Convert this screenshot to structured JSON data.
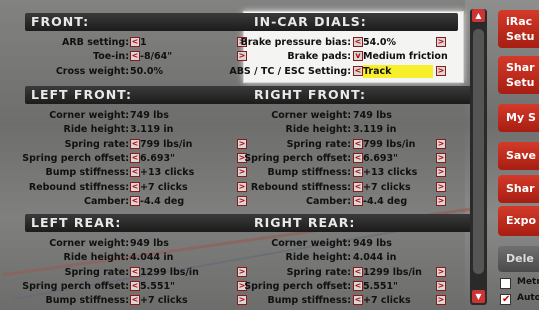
{
  "front": {
    "title": "FRONT:",
    "rows": [
      {
        "label": "ARB setting:",
        "value": "1",
        "adjustable": true
      },
      {
        "label": "Toe-in:",
        "value": "-8/64\"",
        "adjustable": true
      },
      {
        "label": "Cross weight:",
        "value": "50.0%",
        "adjustable": false
      }
    ]
  },
  "dials": {
    "title": "IN-CAR DIALS:",
    "rows": [
      {
        "label": "Brake pressure bias:",
        "value": "54.0%",
        "adjustable": true
      },
      {
        "label": "Brake pads:",
        "value": "Medium friction",
        "adjustable": "dropdown"
      },
      {
        "label": "ABS / TC / ESC Setting:",
        "value": "Track",
        "adjustable": true,
        "highlight": true
      }
    ]
  },
  "left_front": {
    "title": "LEFT FRONT:",
    "rows": [
      {
        "label": "Corner weight:",
        "value": "749 lbs",
        "adjustable": false
      },
      {
        "label": "Ride height:",
        "value": "3.119 in",
        "adjustable": false
      },
      {
        "label": "Spring rate:",
        "value": "799 lbs/in",
        "adjustable": true
      },
      {
        "label": "Spring perch offset:",
        "value": "6.693\"",
        "adjustable": true
      },
      {
        "label": "Bump stiffness:",
        "value": "+13 clicks",
        "adjustable": true
      },
      {
        "label": "Rebound stiffness:",
        "value": "+7 clicks",
        "adjustable": true
      },
      {
        "label": "Camber:",
        "value": "-4.4 deg",
        "adjustable": true
      }
    ]
  },
  "right_front": {
    "title": "RIGHT FRONT:",
    "rows": [
      {
        "label": "Corner weight:",
        "value": "749 lbs",
        "adjustable": false
      },
      {
        "label": "Ride height:",
        "value": "3.119 in",
        "adjustable": false
      },
      {
        "label": "Spring rate:",
        "value": "799 lbs/in",
        "adjustable": true
      },
      {
        "label": "Spring perch offset:",
        "value": "6.693\"",
        "adjustable": true
      },
      {
        "label": "Bump stiffness:",
        "value": "+13 clicks",
        "adjustable": true
      },
      {
        "label": "Rebound stiffness:",
        "value": "+7 clicks",
        "adjustable": true
      },
      {
        "label": "Camber:",
        "value": "-4.4 deg",
        "adjustable": true
      }
    ]
  },
  "left_rear": {
    "title": "LEFT REAR:",
    "rows": [
      {
        "label": "Corner weight:",
        "value": "949 lbs",
        "adjustable": false
      },
      {
        "label": "Ride height:",
        "value": "4.044 in",
        "adjustable": false
      },
      {
        "label": "Spring rate:",
        "value": "1299 lbs/in",
        "adjustable": true
      },
      {
        "label": "Spring perch offset:",
        "value": "5.551\"",
        "adjustable": true
      },
      {
        "label": "Bump stiffness:",
        "value": "+7 clicks",
        "adjustable": true
      }
    ]
  },
  "right_rear": {
    "title": "RIGHT REAR:",
    "rows": [
      {
        "label": "Corner weight:",
        "value": "949 lbs",
        "adjustable": false
      },
      {
        "label": "Ride height:",
        "value": "4.044 in",
        "adjustable": false
      },
      {
        "label": "Spring rate:",
        "value": "1299 lbs/in",
        "adjustable": true
      },
      {
        "label": "Spring perch offset:",
        "value": "5.551\"",
        "adjustable": true
      },
      {
        "label": "Bump stiffness:",
        "value": "+7 clicks",
        "adjustable": true
      }
    ]
  },
  "sidebar": {
    "buttons": [
      {
        "label": "iRac\nSetu",
        "style": "red"
      },
      {
        "label": "Shar\nSetu",
        "style": "red"
      },
      {
        "label": "My S",
        "style": "red"
      },
      {
        "label": "Save",
        "style": "red"
      },
      {
        "label": "Shar",
        "style": "red"
      },
      {
        "label": "Expo",
        "style": "red"
      },
      {
        "label": "Dele",
        "style": "gray"
      }
    ],
    "checkboxes": [
      {
        "label": "Metr",
        "checked": false
      },
      {
        "label": "Auto",
        "checked": true
      }
    ]
  },
  "icons": {
    "decrement": "<",
    "increment": ">",
    "dropdown": "v",
    "scroll_up": "▲",
    "scroll_down": "▼"
  },
  "colors": {
    "accent": "#c8281c",
    "highlight": "#f7ef2a",
    "header_bg": "#222222"
  }
}
